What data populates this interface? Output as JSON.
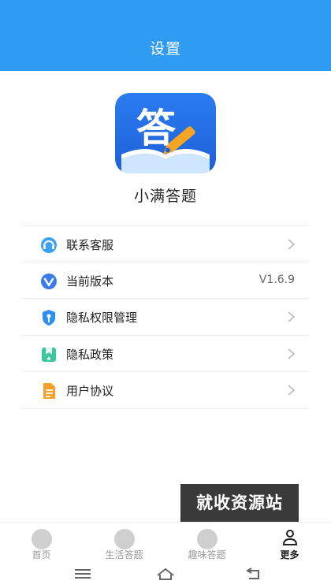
{
  "header": {
    "title": "设置"
  },
  "app": {
    "name": "小满答题",
    "logo_char": "答"
  },
  "menu": [
    {
      "label": "联系客服",
      "icon": "headset-icon",
      "chevron": true
    },
    {
      "label": "当前版本",
      "icon": "version-icon",
      "value": "V1.6.9"
    },
    {
      "label": "隐私权限管理",
      "icon": "shield-key-icon",
      "chevron": true
    },
    {
      "label": "隐私政策",
      "icon": "privacy-policy-icon",
      "chevron": true
    },
    {
      "label": "用户协议",
      "icon": "document-icon",
      "chevron": true
    }
  ],
  "watermark": {
    "text": "就收资源站"
  },
  "tabbar": {
    "tabs": [
      {
        "label": "首页",
        "active": false
      },
      {
        "label": "生活答题",
        "active": false
      },
      {
        "label": "趣味答题",
        "active": false
      },
      {
        "label": "更多",
        "active": true
      }
    ]
  },
  "colors": {
    "header_bg": "#2f9bf2",
    "accent": "#2f9bf2"
  }
}
